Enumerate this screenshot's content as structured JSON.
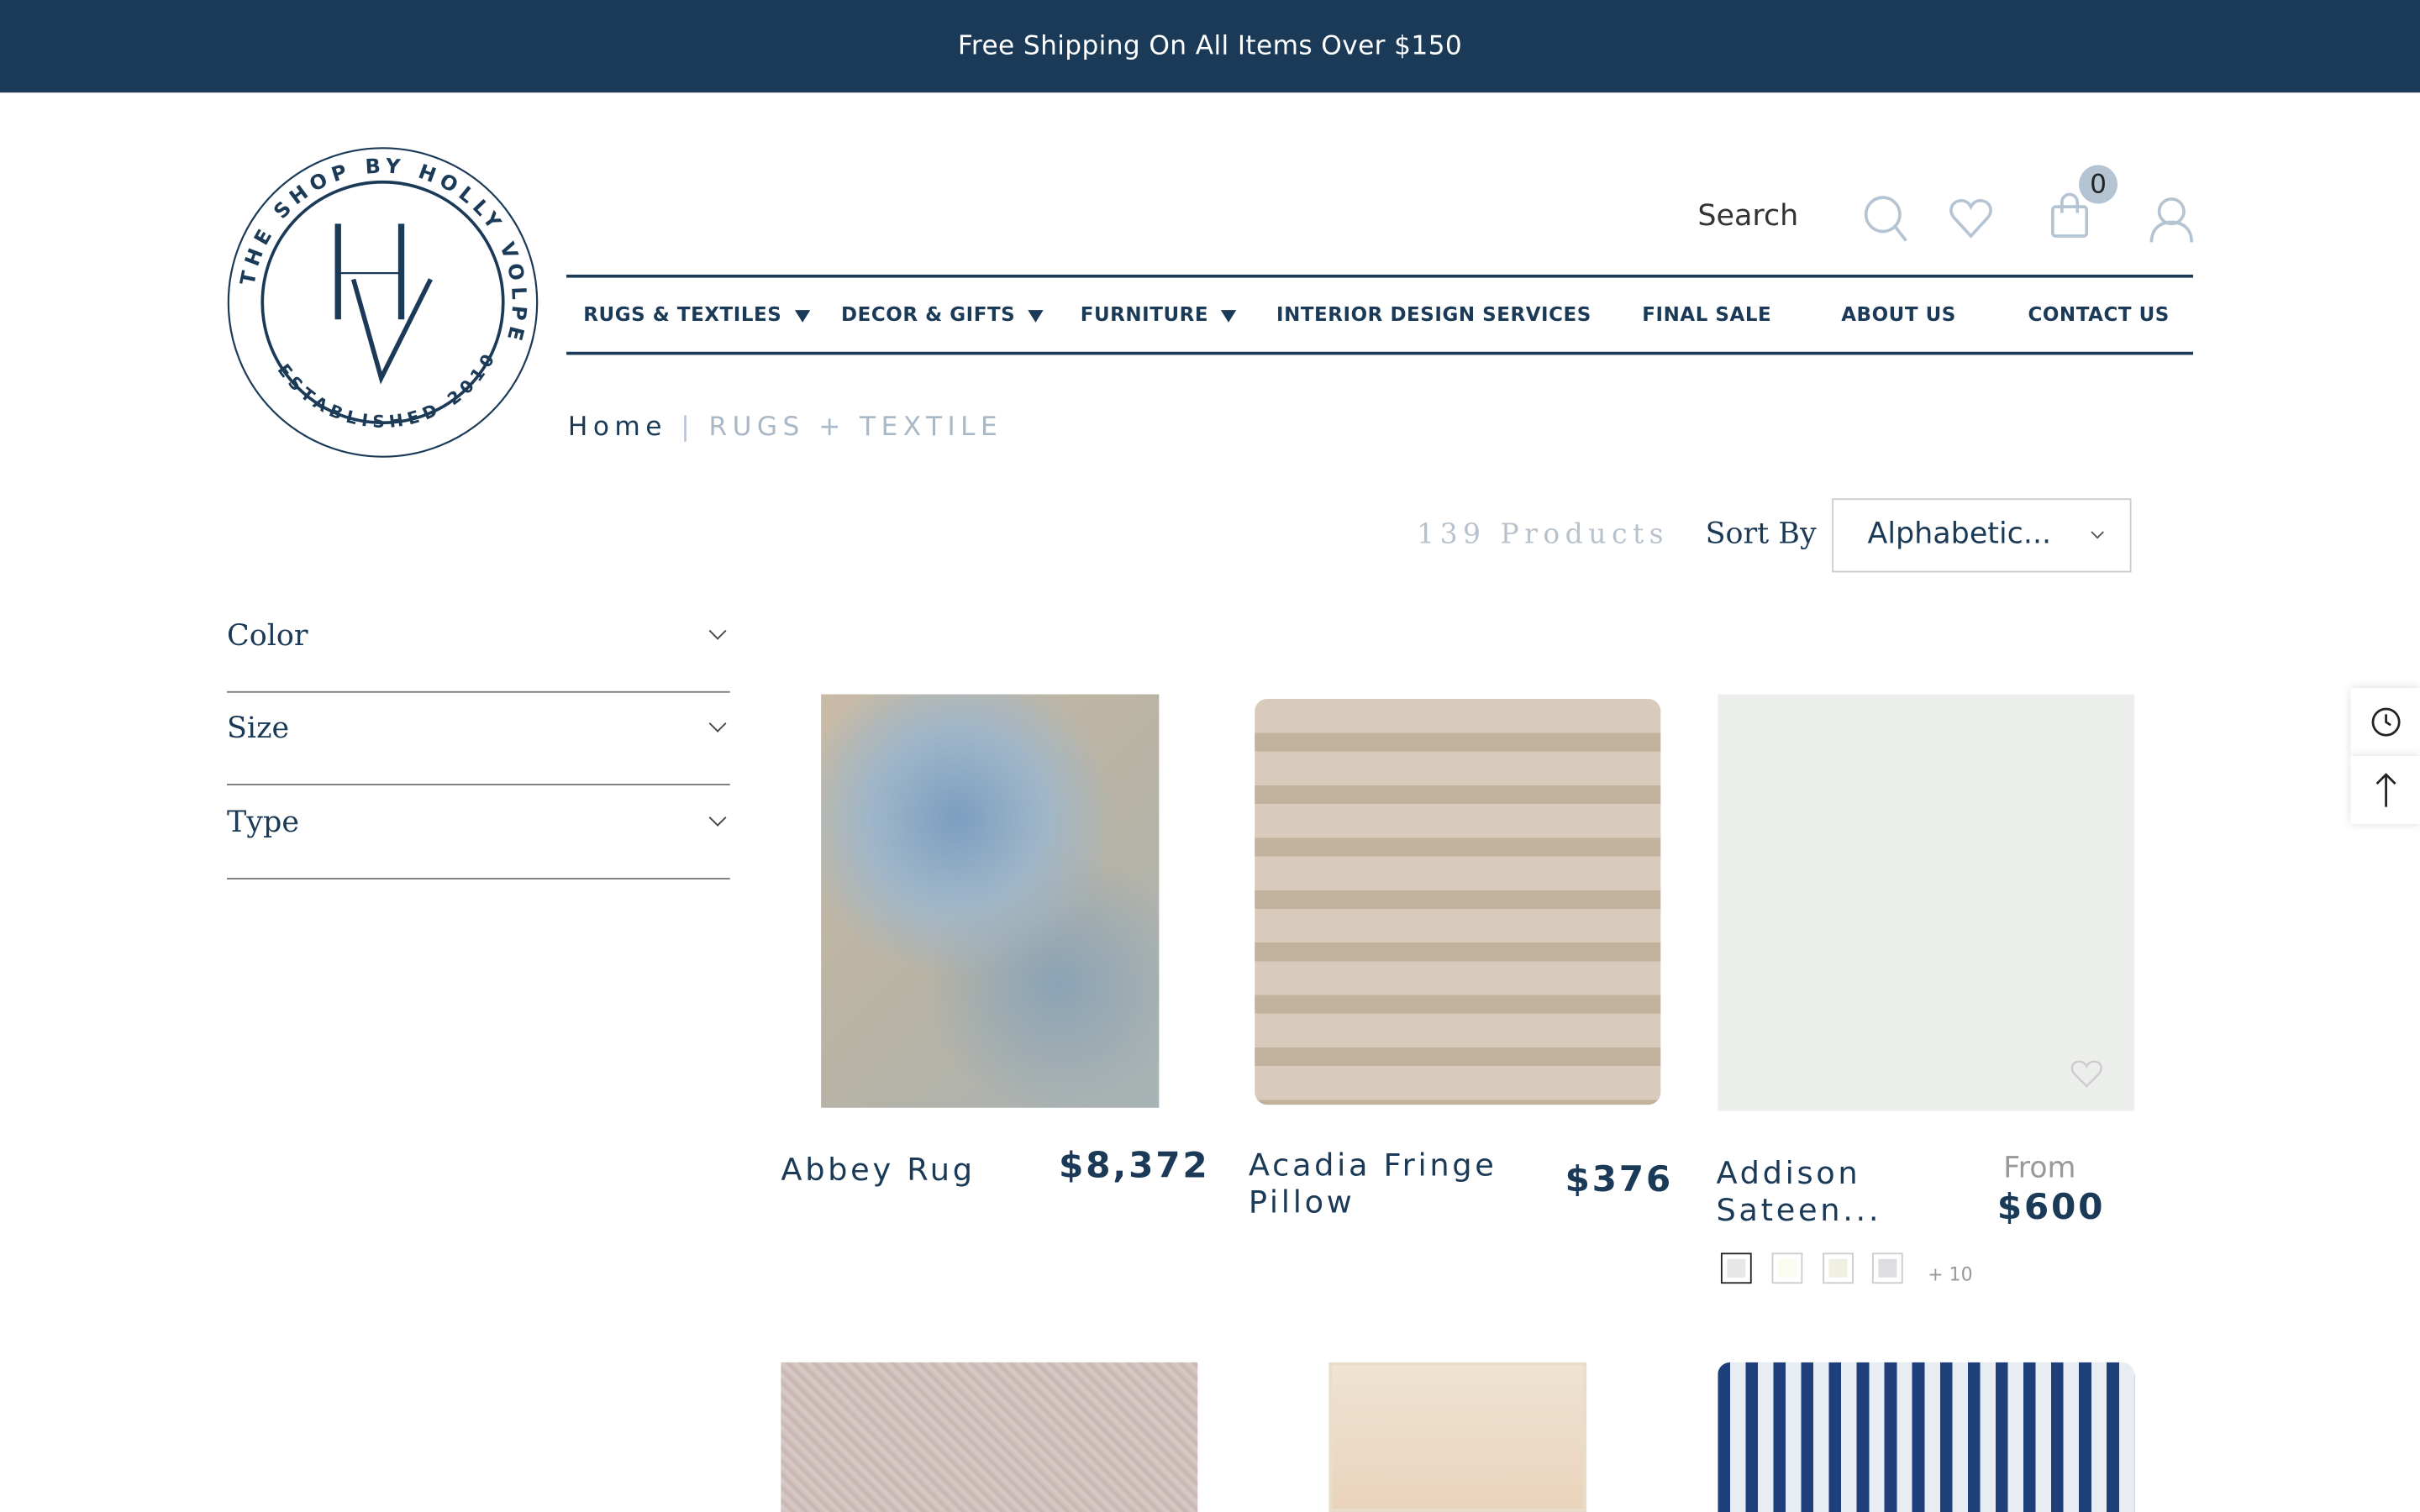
{
  "announcement": "Free Shipping On All Items Over $150",
  "logo": {
    "ring_text_top": "THE SHOP BY HOLLY VOLPE",
    "ring_text_bottom": "ESTABLISHED 2010",
    "monogram": "HV"
  },
  "header": {
    "search_label": "Search",
    "cart_count": "0",
    "icons": [
      "search-icon",
      "heart-icon",
      "shopping-bag-icon",
      "user-icon"
    ]
  },
  "nav": [
    {
      "label": "RUGS & TEXTILES",
      "dropdown": true
    },
    {
      "label": "DECOR & GIFTS",
      "dropdown": true
    },
    {
      "label": "FURNITURE",
      "dropdown": true
    },
    {
      "label": "INTERIOR DESIGN SERVICES"
    },
    {
      "label": "FINAL SALE"
    },
    {
      "label": "ABOUT US"
    },
    {
      "label": "CONTACT US"
    }
  ],
  "breadcrumb": {
    "home": "Home",
    "separator": "|",
    "current": "RUGS + TEXTILE"
  },
  "toolbar": {
    "count": "139 Products",
    "sort_label": "Sort By",
    "sort_value": "Alphabetic..."
  },
  "filters": [
    "Color",
    "Size",
    "Type"
  ],
  "products": [
    {
      "name": "Abbey Rug",
      "price": "$8,372"
    },
    {
      "name": "Acadia Fringe Pillow",
      "name_line1": "Acadia Fringe",
      "name_line2": "Pillow",
      "price": "$376"
    },
    {
      "name_line1": "Addison",
      "name_line2": "Sateen...",
      "price_prefix": "From",
      "price": "$600",
      "swatches": [
        "#e6e8e8",
        "#fbfbf0",
        "#f0f0e2",
        "#dedee2"
      ],
      "more_swatches": "+ 10"
    }
  ],
  "colors": {
    "brand": "#1b3a57",
    "icon": "#b5c4d3"
  }
}
